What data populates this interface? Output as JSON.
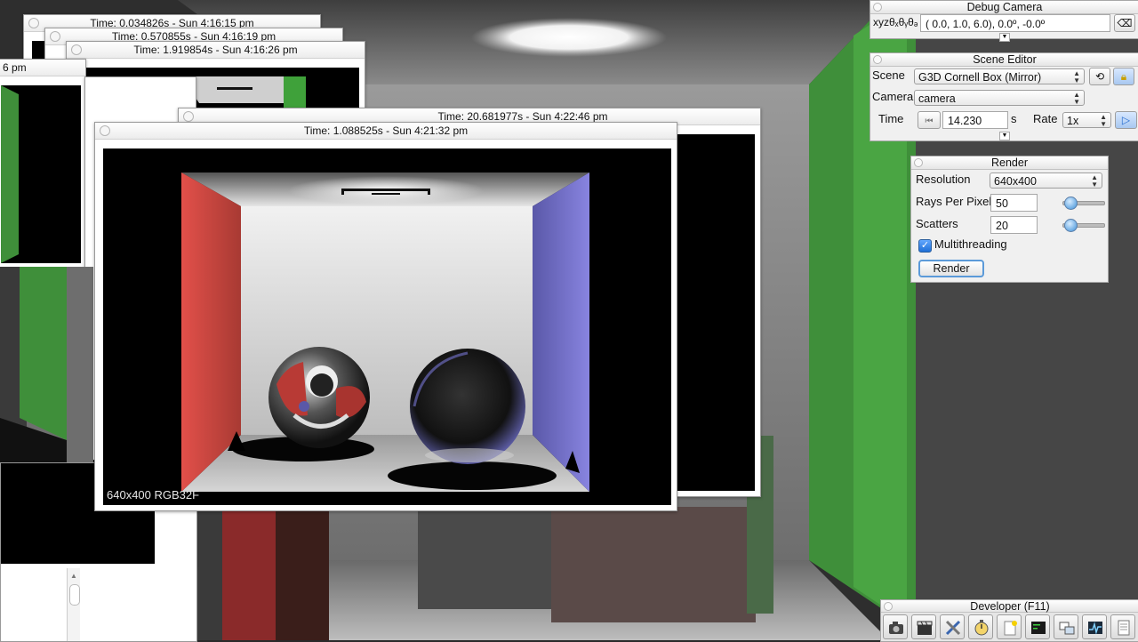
{
  "background_windows": [
    {
      "title": "Time: 0.034826s - Sun 4:16:15 pm"
    },
    {
      "title": "Time: 0.570855s - Sun 4:16:19 pm"
    },
    {
      "title": "Time: 1.919854s - Sun 4:16:26 pm"
    },
    {
      "title": "6 pm"
    },
    {
      "title": "Time: 20.681977s - Sun 4:22:46 pm"
    }
  ],
  "render_window": {
    "title": "Time: 1.088525s - Sun 4:21:32 pm",
    "caption": "640x400 RGB32F"
  },
  "debug_camera": {
    "title": "Debug Camera",
    "label": "xyzθₓθᵧθₔ",
    "value": "( 0.0,   1.0,   6.0),   0.0º,  -0.0º"
  },
  "scene_editor": {
    "title": "Scene Editor",
    "scene_label": "Scene",
    "scene_value": "G3D Cornell Box (Mirror)",
    "camera_label": "Camera",
    "camera_value": "camera",
    "time_label": "Time",
    "time_value": "14.230",
    "time_unit": "s",
    "rate_label": "Rate",
    "rate_value": "1x"
  },
  "render_panel": {
    "title": "Render",
    "resolution_label": "Resolution",
    "resolution_value": "640x400",
    "rays_label": "Rays Per Pixel",
    "rays_value": "50",
    "rays_slider_fraction": 0.05,
    "scatters_label": "Scatters",
    "scatters_value": "20",
    "scatters_slider_fraction": 0.05,
    "multithreading_label": "Multithreading",
    "multithreading_checked": true,
    "render_button": "Render"
  },
  "developer_toolbar": {
    "title": "Developer (F11)",
    "buttons": [
      "camera-icon",
      "clapperboard-icon",
      "tools-icon",
      "stopwatch-icon",
      "new-file-icon",
      "terminal-icon",
      "windows-icon",
      "profiler-icon",
      "document-icon"
    ]
  }
}
